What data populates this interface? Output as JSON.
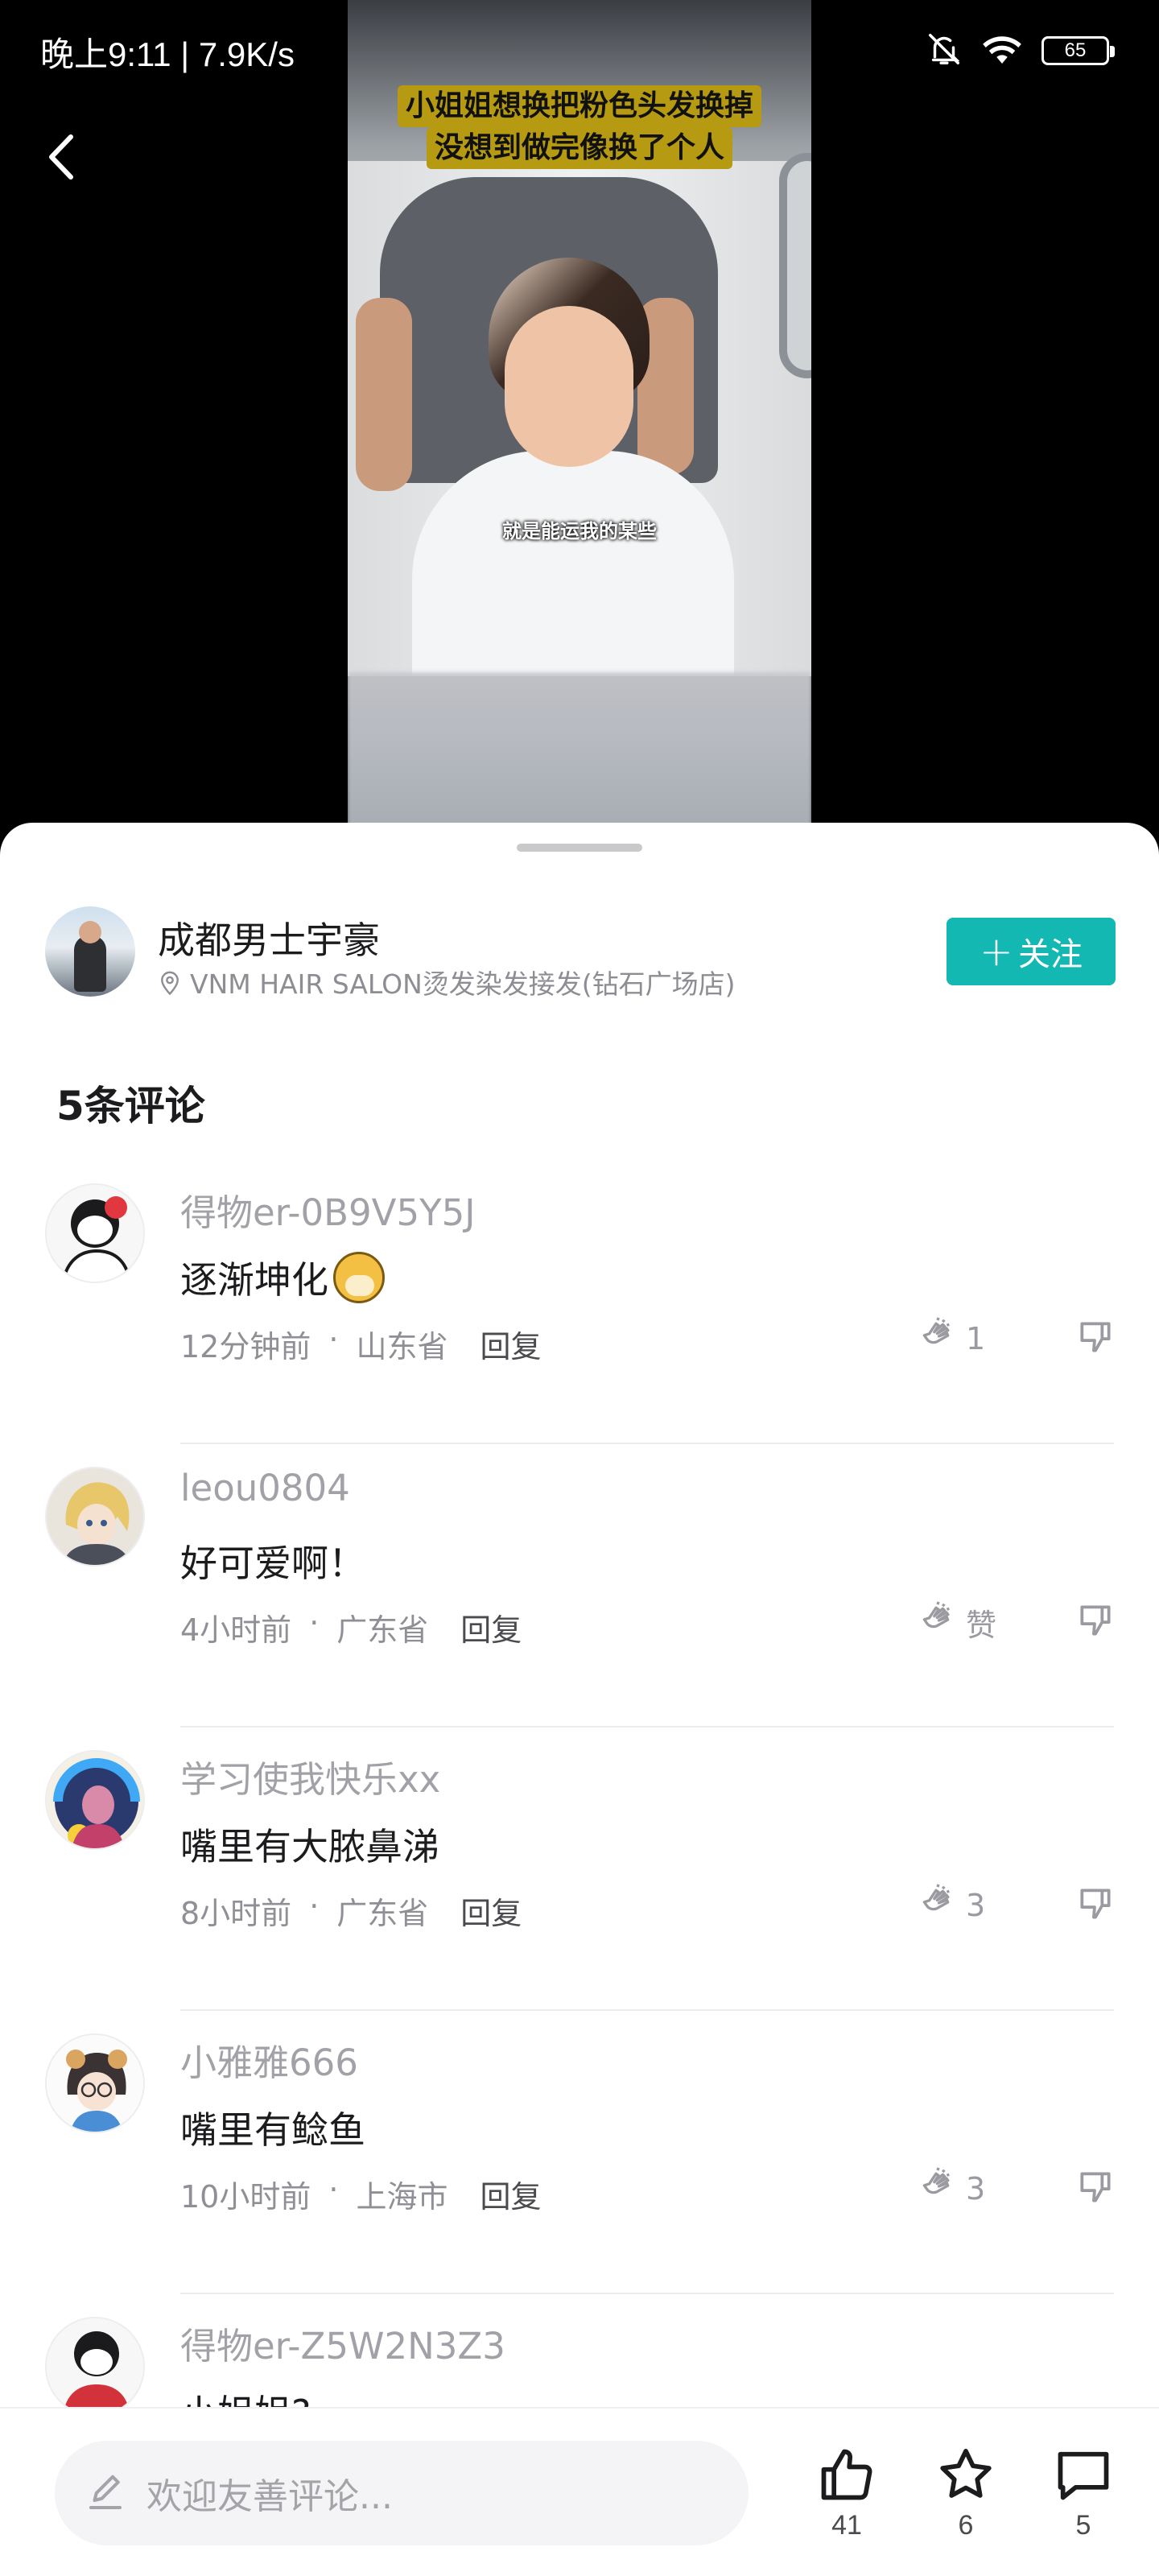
{
  "status_bar": {
    "time_speed": "晚上9:11 | 7.9K/s",
    "battery": "65"
  },
  "video": {
    "caption_line1": "小姐姐想换把粉色头发换掉",
    "caption_line2": "没想到做完像换了个人",
    "subtitle": "就是能运我的某些"
  },
  "author": {
    "name": "成都男士宇豪",
    "location": "VNM HAIR SALON烫发染发接发(钻石广场店)",
    "follow_label": "关注"
  },
  "comments_header": "5条评论",
  "comments": [
    {
      "user": "得物er-0B9V5Y5J",
      "text": "逐渐坤化",
      "time": "12分钟前",
      "region": "山东省",
      "reply": "回复",
      "likes": "1"
    },
    {
      "user": "leou0804",
      "text": "好可爱啊！",
      "time": "4小时前",
      "region": "广东省",
      "reply": "回复",
      "likes": "赞"
    },
    {
      "user": "学习使我快乐xx",
      "text": "嘴里有大脓鼻涕",
      "time": "8小时前",
      "region": "广东省",
      "reply": "回复",
      "likes": "3"
    },
    {
      "user": "小雅雅666",
      "text": "嘴里有鲶鱼",
      "time": "10小时前",
      "region": "上海市",
      "reply": "回复",
      "likes": "3"
    },
    {
      "user": "得物er-Z5W2N3Z3",
      "text": "小姐姐?",
      "time": "",
      "region": "",
      "reply": "",
      "likes": ""
    }
  ],
  "bottom_bar": {
    "input_placeholder": "欢迎友善评论...",
    "like_count": "41",
    "favorite_count": "6",
    "comment_count": "5"
  },
  "colors": {
    "accent": "#13B8B3",
    "text_primary": "#1C1C1E",
    "text_secondary": "#8F8F95",
    "video_caption_bg": "#B59A12"
  },
  "icons": [
    "back-icon",
    "mute-icon",
    "wifi-icon",
    "battery-icon",
    "location-pin-icon",
    "clap-icon",
    "dislike-icon",
    "pencil-icon",
    "thumbs-up-icon",
    "star-icon",
    "comment-icon"
  ]
}
